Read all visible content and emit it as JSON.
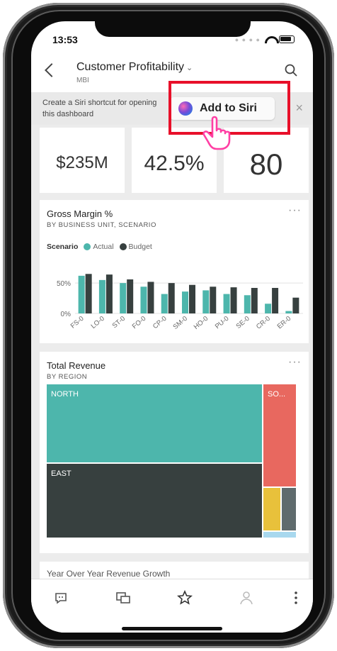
{
  "status": {
    "time": "13:53"
  },
  "header": {
    "title": "Customer Profitability",
    "subtitle": "MBI"
  },
  "siri_banner": {
    "text": "Create a Siri shortcut for opening this dashboard",
    "button_label": "Add to Siri",
    "close_glyph": "×"
  },
  "kpis": [
    {
      "value": "$235M"
    },
    {
      "value": "42.5%"
    },
    {
      "value": "80"
    }
  ],
  "gross_margin_card": {
    "title": "Gross Margin %",
    "subtitle": "BY BUSINESS UNIT, SCENARIO",
    "more": "···",
    "legend_title": "Scenario",
    "legend_items": [
      {
        "label": "Actual",
        "color": "#4db6ac"
      },
      {
        "label": "Budget",
        "color": "#37403f"
      }
    ]
  },
  "chart_data": {
    "type": "bar",
    "title": "Gross Margin %",
    "subtitle": "BY BUSINESS UNIT, SCENARIO",
    "categories": [
      "FS-0",
      "LO-0",
      "ST-0",
      "FO-0",
      "CP-0",
      "SM-0",
      "HO-0",
      "PU-0",
      "SE-0",
      "CR-0",
      "ER-0"
    ],
    "series": [
      {
        "name": "Actual",
        "color": "#4db6ac",
        "values": [
          62,
          55,
          50,
          44,
          32,
          36,
          38,
          32,
          30,
          16,
          4
        ]
      },
      {
        "name": "Budget",
        "color": "#37403f",
        "values": [
          65,
          64,
          56,
          52,
          50,
          47,
          44,
          43,
          42,
          42,
          26
        ]
      }
    ],
    "yticks": [
      "50%",
      "0%"
    ],
    "ylim": [
      0,
      70
    ],
    "grid": true,
    "legend": "top-left"
  },
  "revenue_card": {
    "title": "Total Revenue",
    "subtitle": "BY REGION",
    "more": "···",
    "tiles": [
      {
        "label": "NORTH",
        "color": "#4db6ac"
      },
      {
        "label": "EAST",
        "color": "#37403f"
      },
      {
        "label": "SO...",
        "color": "#e8685f"
      },
      {
        "label": "",
        "color": "#e8c13b"
      },
      {
        "label": "",
        "color": "#5f6b6d"
      },
      {
        "label": "",
        "color": "#a8d8ee"
      }
    ]
  },
  "yoy_card": {
    "title": "Year Over Year Revenue Growth"
  },
  "tabbar": {
    "items": [
      "comment-icon",
      "dashboards-icon",
      "favorites-star-icon",
      "user-icon",
      "more-icon"
    ]
  },
  "accent": {
    "highlight": "#e8102a",
    "cursor": "#ff3fa4"
  }
}
